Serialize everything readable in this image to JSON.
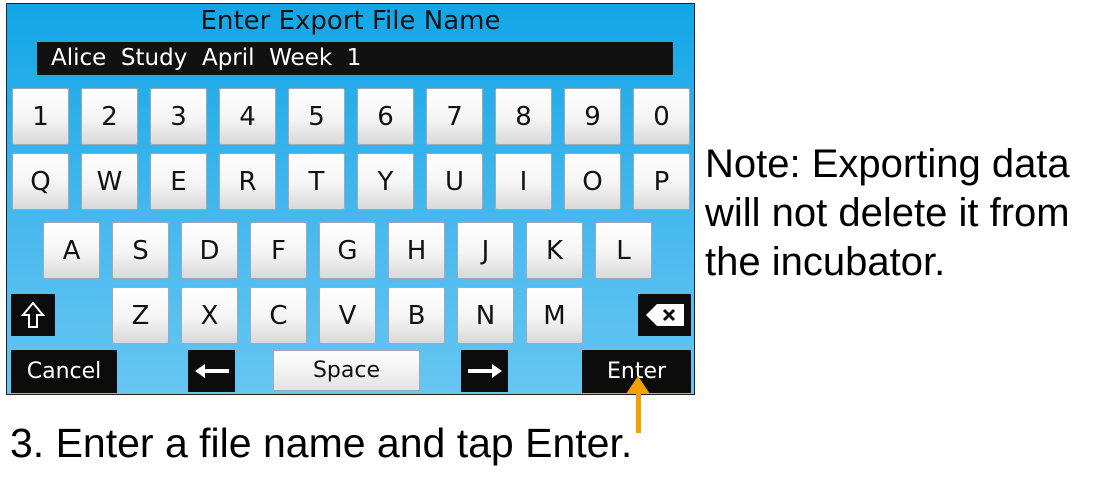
{
  "dialog": {
    "title": "Enter Export File Name",
    "filename_value": "Alice  Study  April  Week  1"
  },
  "keyboard": {
    "row1": [
      "1",
      "2",
      "3",
      "4",
      "5",
      "6",
      "7",
      "8",
      "9",
      "0"
    ],
    "row2": [
      "Q",
      "W",
      "E",
      "R",
      "T",
      "Y",
      "U",
      "I",
      "O",
      "P"
    ],
    "row3": [
      "A",
      "S",
      "D",
      "F",
      "G",
      "H",
      "J",
      "K",
      "L"
    ],
    "row4": [
      "Z",
      "X",
      "C",
      "V",
      "B",
      "N",
      "M"
    ],
    "cancel_label": "Cancel",
    "space_label": "Space",
    "enter_label": "Enter",
    "shift_icon": "shift-arrow-icon",
    "backspace_icon": "backspace-icon",
    "left_icon": "left-arrow-icon",
    "right_icon": "right-arrow-icon"
  },
  "annotation": {
    "note": "Note: Exporting data will not delete it from the incubator.",
    "step": "3. Enter a file name and tap Enter.",
    "arrow_color": "#f4a000"
  }
}
